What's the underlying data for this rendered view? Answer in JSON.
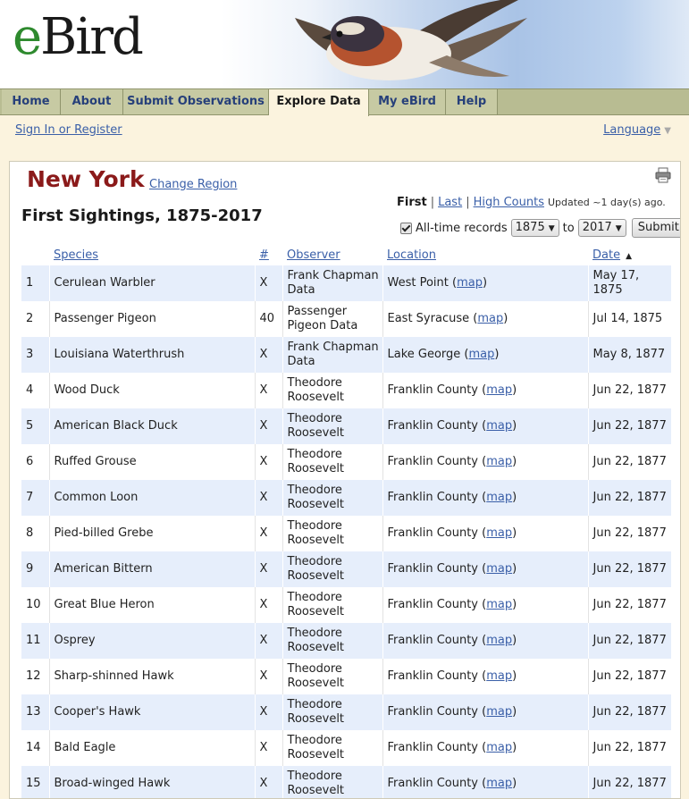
{
  "brand": {
    "logo_e": "e",
    "logo_rest": "Bird"
  },
  "nav": {
    "tabs": [
      {
        "label": "Home"
      },
      {
        "label": "About"
      },
      {
        "label": "Submit Observations"
      },
      {
        "label": "Explore Data"
      },
      {
        "label": "My eBird"
      },
      {
        "label": "Help"
      }
    ],
    "active": "Explore Data"
  },
  "account": {
    "signin_label": "Sign In or Register"
  },
  "language": {
    "label": "Language",
    "icon": "caret-down-icon"
  },
  "region": {
    "name": "New York",
    "change_label": "Change Region"
  },
  "print": {
    "icon": "printer-icon"
  },
  "page": {
    "heading": "First Sightings, 1875-2017"
  },
  "views": {
    "first": "First",
    "last": "Last",
    "high_counts": "High Counts",
    "updated": "Updated ~1 day(s) ago.",
    "separator": "|"
  },
  "filters": {
    "alltime_checked": true,
    "alltime_label": "All-time records",
    "from_year": "1875",
    "to_label": "to",
    "to_year": "2017",
    "submit_label": "Submit"
  },
  "table": {
    "columns": {
      "species": "Species",
      "count": "#",
      "observer": "Observer",
      "location": "Location",
      "date": "Date"
    },
    "sort_indicator": "▲",
    "map_label": "map",
    "rows": [
      {
        "n": "1",
        "species": "Cerulean Warbler",
        "count": "X",
        "observer": "Frank Chapman Data",
        "location": "West Point",
        "date": "May 17, 1875"
      },
      {
        "n": "2",
        "species": "Passenger Pigeon",
        "count": "40",
        "observer": "Passenger Pigeon Data",
        "location": "East Syracuse",
        "date": "Jul 14, 1875"
      },
      {
        "n": "3",
        "species": "Louisiana Waterthrush",
        "count": "X",
        "observer": "Frank Chapman Data",
        "location": "Lake George",
        "date": "May 8, 1877"
      },
      {
        "n": "4",
        "species": "Wood Duck",
        "count": "X",
        "observer": "Theodore Roosevelt",
        "location": "Franklin County",
        "date": "Jun 22, 1877"
      },
      {
        "n": "5",
        "species": "American Black Duck",
        "count": "X",
        "observer": "Theodore Roosevelt",
        "location": "Franklin County",
        "date": "Jun 22, 1877"
      },
      {
        "n": "6",
        "species": "Ruffed Grouse",
        "count": "X",
        "observer": "Theodore Roosevelt",
        "location": "Franklin County",
        "date": "Jun 22, 1877"
      },
      {
        "n": "7",
        "species": "Common Loon",
        "count": "X",
        "observer": "Theodore Roosevelt",
        "location": "Franklin County",
        "date": "Jun 22, 1877"
      },
      {
        "n": "8",
        "species": "Pied-billed Grebe",
        "count": "X",
        "observer": "Theodore Roosevelt",
        "location": "Franklin County",
        "date": "Jun 22, 1877"
      },
      {
        "n": "9",
        "species": "American Bittern",
        "count": "X",
        "observer": "Theodore Roosevelt",
        "location": "Franklin County",
        "date": "Jun 22, 1877"
      },
      {
        "n": "10",
        "species": "Great Blue Heron",
        "count": "X",
        "observer": "Theodore Roosevelt",
        "location": "Franklin County",
        "date": "Jun 22, 1877"
      },
      {
        "n": "11",
        "species": "Osprey",
        "count": "X",
        "observer": "Theodore Roosevelt",
        "location": "Franklin County",
        "date": "Jun 22, 1877"
      },
      {
        "n": "12",
        "species": "Sharp-shinned Hawk",
        "count": "X",
        "observer": "Theodore Roosevelt",
        "location": "Franklin County",
        "date": "Jun 22, 1877"
      },
      {
        "n": "13",
        "species": "Cooper's Hawk",
        "count": "X",
        "observer": "Theodore Roosevelt",
        "location": "Franklin County",
        "date": "Jun 22, 1877"
      },
      {
        "n": "14",
        "species": "Bald Eagle",
        "count": "X",
        "observer": "Theodore Roosevelt",
        "location": "Franklin County",
        "date": "Jun 22, 1877"
      },
      {
        "n": "15",
        "species": "Broad-winged Hawk",
        "count": "X",
        "observer": "Theodore Roosevelt",
        "location": "Franklin County",
        "date": "Jun 22, 1877"
      }
    ]
  },
  "colors": {
    "region_title": "#8b1a1a",
    "link": "#3a5fa8",
    "nav_bg": "#b8bc92",
    "row_alt": "#e6eefb",
    "page_bg": "#fbf3de"
  }
}
